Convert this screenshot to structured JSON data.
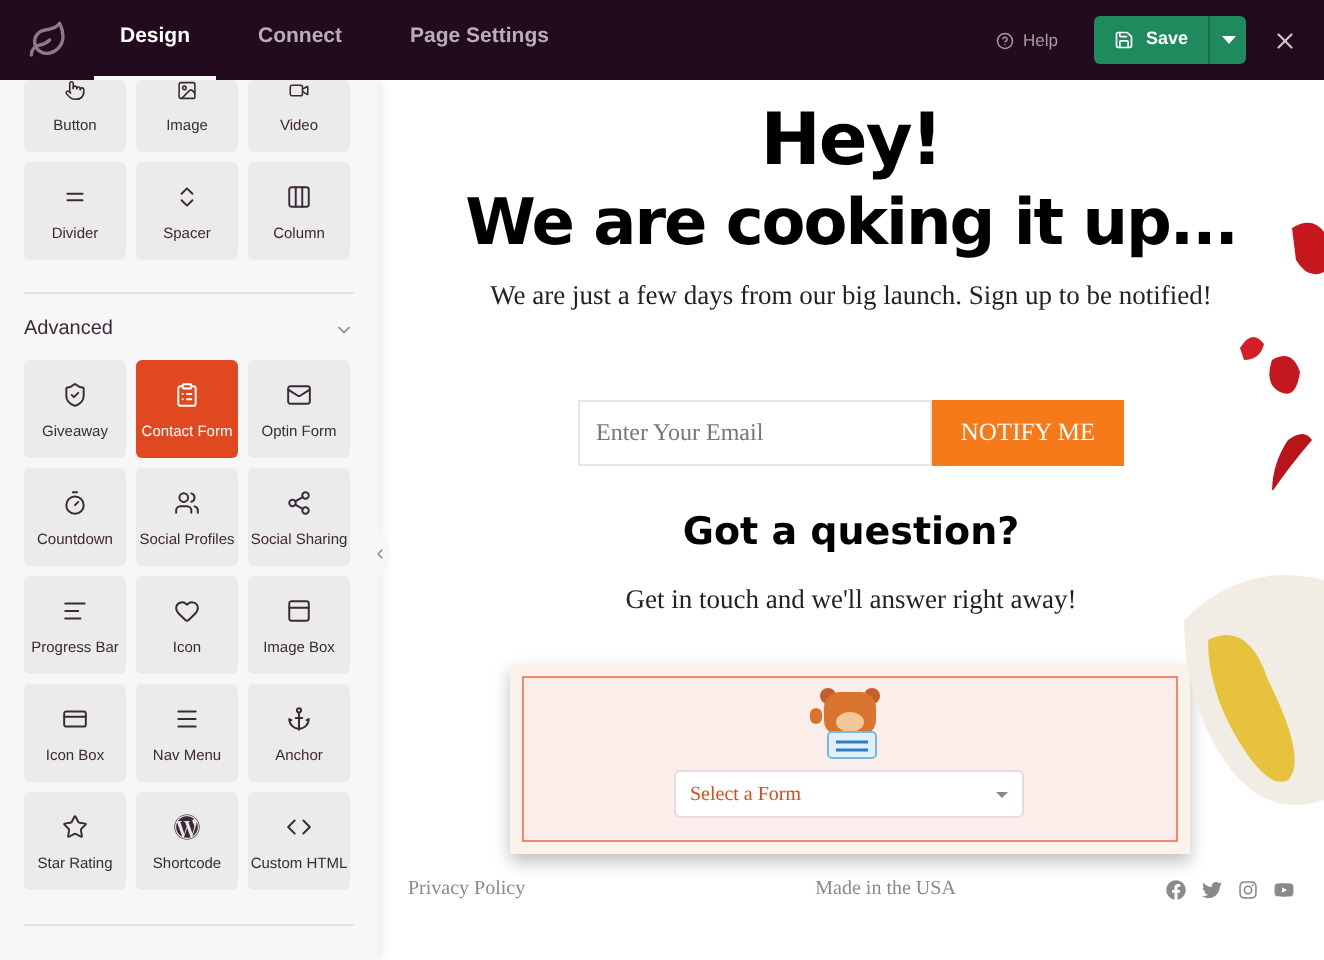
{
  "topbar": {
    "tabs": [
      {
        "label": "Design",
        "selected": true
      },
      {
        "label": "Connect",
        "selected": false
      },
      {
        "label": "Page Settings",
        "selected": false
      }
    ],
    "help": "Help",
    "save": "Save"
  },
  "sidebar": {
    "basic_blocks": [
      {
        "label": "Button",
        "selected": false
      },
      {
        "label": "Image",
        "selected": false
      },
      {
        "label": "Video",
        "selected": false
      },
      {
        "label": "Divider",
        "selected": false
      },
      {
        "label": "Spacer",
        "selected": false
      },
      {
        "label": "Column",
        "selected": false
      }
    ],
    "advanced": {
      "title": "Advanced",
      "expanded": true,
      "blocks": [
        {
          "label": "Giveaway",
          "selected": false
        },
        {
          "label": "Contact Form",
          "selected": true
        },
        {
          "label": "Optin Form",
          "selected": false
        },
        {
          "label": "Countdown",
          "selected": false
        },
        {
          "label": "Social Profiles",
          "selected": false
        },
        {
          "label": "Social Sharing",
          "selected": false
        },
        {
          "label": "Progress Bar",
          "selected": false
        },
        {
          "label": "Icon",
          "selected": false
        },
        {
          "label": "Image Box",
          "selected": false
        },
        {
          "label": "Icon Box",
          "selected": false
        },
        {
          "label": "Nav Menu",
          "selected": false
        },
        {
          "label": "Anchor",
          "selected": false
        },
        {
          "label": "Star Rating",
          "selected": false
        },
        {
          "label": "Shortcode",
          "selected": false
        },
        {
          "label": "Custom HTML",
          "selected": false
        }
      ]
    }
  },
  "page": {
    "headline": [
      "Hey!",
      "We are cooking it up..."
    ],
    "subtitle": "We are just a few days from our big launch. Sign up to be notified!",
    "email": {
      "placeholder": "Enter Your Email",
      "button": "NOTIFY ME"
    },
    "question": "Got a question?",
    "question_text": "Get in touch and we'll answer right away!",
    "form_select": {
      "placeholder": "Select a Form"
    },
    "footer": {
      "left": "Privacy Policy",
      "center": "Made in the USA"
    }
  }
}
